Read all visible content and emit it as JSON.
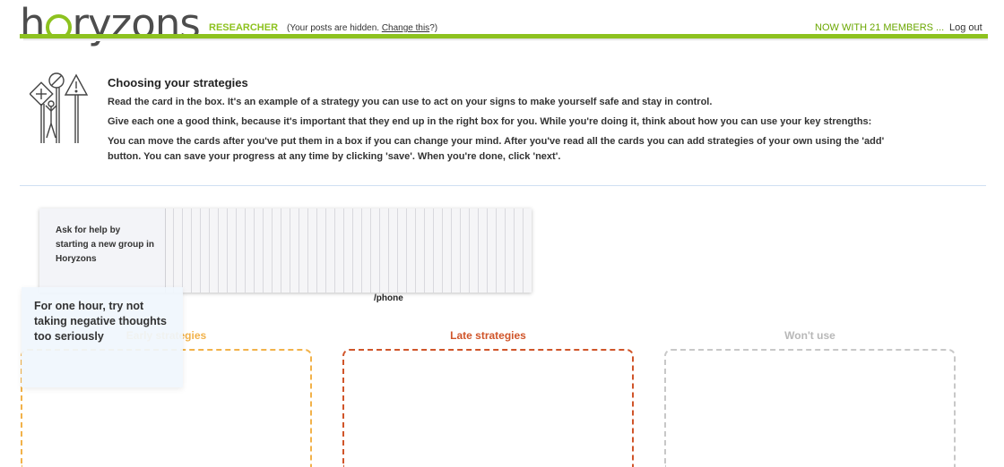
{
  "header": {
    "logo_before": "h",
    "logo_after": "ryzons",
    "role": "RESEARCHER",
    "role_note_prefix": "(Your posts are hidden. ",
    "role_note_link": "Change this",
    "role_note_suffix": "?)",
    "members": "NOW WITH 21 MEMBERS ...",
    "logout": "Log out",
    "accent_color": "#8dc21f"
  },
  "intro": {
    "icon": "strategy-signs-icon",
    "title": "Choosing your strategies",
    "p1": "Read the card in the box. It's an example of a strategy you can use to act on your signs to make yourself safe and stay in control.",
    "p2": "Give each one a good think, because it's important that they end up in the right box for you. While you're doing it, think about how you can use your key strengths:",
    "p3a": "You can move the cards after you've put them in a box if you can change your mind. After you've read all the cards you can add strategies of your own using the 'add'",
    "p3b": "button. You can save your progress at any time by clicking 'save'. When you're done, click 'next'."
  },
  "card_stack": {
    "top_card": "Ask for help by starting a new group in Horyzons",
    "below_label": "/phone"
  },
  "dragged_card": {
    "text": "For one hour, try not taking negative thoughts too seriously"
  },
  "boxes": [
    {
      "label": "Early strategies",
      "color": "#f2b24a"
    },
    {
      "label": "Late strategies",
      "color": "#d0552a"
    },
    {
      "label": "Won't use",
      "color": "#b8b8b8"
    }
  ]
}
